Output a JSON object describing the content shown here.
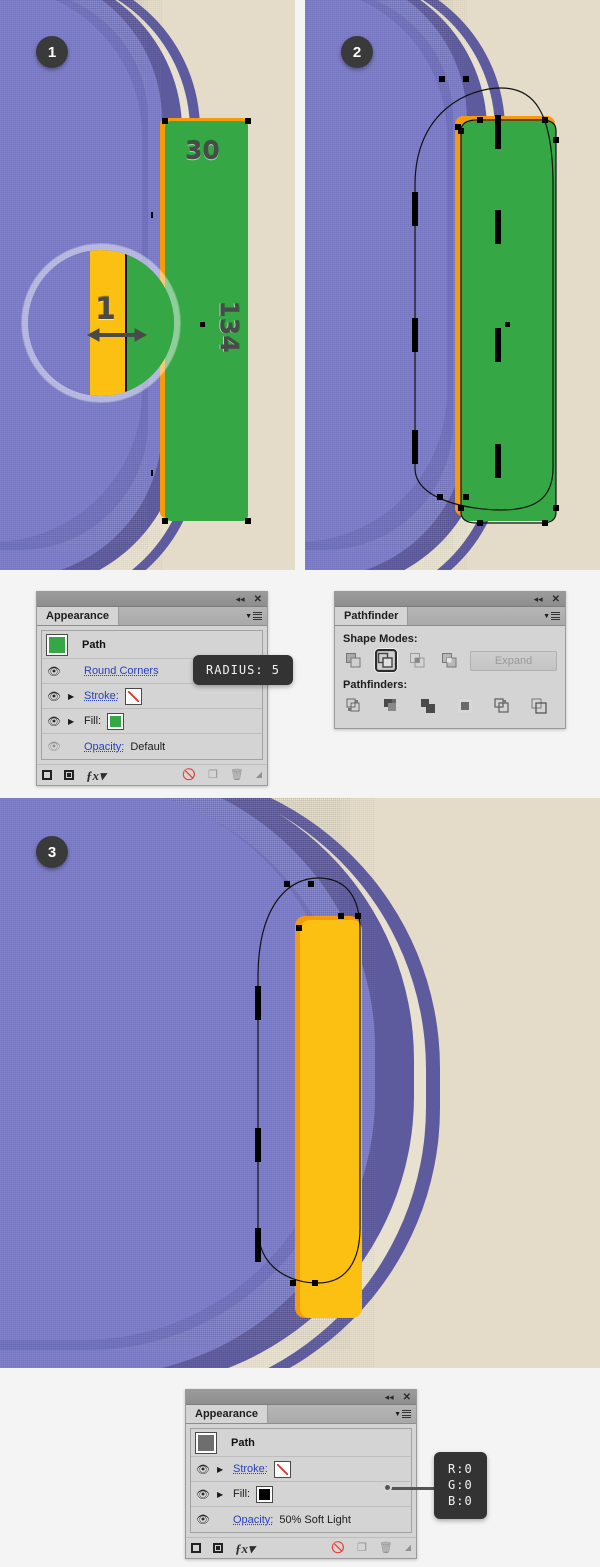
{
  "steps": [
    {
      "number": "1",
      "measure_width": "30",
      "measure_height": "134",
      "magnified_value": "1"
    },
    {
      "number": "2"
    },
    {
      "number": "3"
    }
  ],
  "appearance_panel_top": {
    "title": "Appearance",
    "collapse_icon": "collapse-double-arrow-icon",
    "close_icon": "close-icon",
    "menu_icon": "panel-menu-icon",
    "target_label": "Path",
    "target_swatch_color": "#35a745",
    "rows": [
      {
        "id": "round-corners",
        "label": "Round Corners",
        "link": true,
        "visible": true,
        "expandable": false
      },
      {
        "id": "stroke",
        "label": "Stroke:",
        "link": true,
        "visible": true,
        "expandable": true,
        "swatch": "none"
      },
      {
        "id": "fill",
        "label": "Fill:",
        "link": false,
        "visible": true,
        "expandable": true,
        "swatch": "#35a745"
      },
      {
        "id": "opacity",
        "label": "Opacity:",
        "value": "Default",
        "link": true,
        "visible": false,
        "expandable": false
      }
    ],
    "footer_icons": [
      "add-new-stroke-icon",
      "add-new-fill-icon",
      "add-new-effect-icon",
      "clear-appearance-icon",
      "duplicate-item-icon",
      "delete-item-icon",
      "resize-grip-icon"
    ]
  },
  "appearance_panel_bottom": {
    "title": "Appearance",
    "collapse_icon": "collapse-double-arrow-icon",
    "close_icon": "close-icon",
    "menu_icon": "panel-menu-icon",
    "target_label": "Path",
    "target_swatch_color": "#6e6e6e",
    "rows": [
      {
        "id": "stroke",
        "label": "Stroke:",
        "link": true,
        "visible": true,
        "expandable": true,
        "swatch": "none"
      },
      {
        "id": "fill",
        "label": "Fill:",
        "link": false,
        "visible": true,
        "expandable": true,
        "swatch": "#000000"
      },
      {
        "id": "opacity",
        "label": "Opacity:",
        "value": "50% Soft Light",
        "link": true,
        "visible": true,
        "expandable": false
      }
    ],
    "footer_icons": [
      "add-new-stroke-icon",
      "add-new-fill-icon",
      "add-new-effect-icon",
      "clear-appearance-icon",
      "duplicate-item-icon",
      "delete-item-icon",
      "resize-grip-icon"
    ]
  },
  "pathfinder_panel": {
    "title": "Pathfinder",
    "collapse_icon": "collapse-double-arrow-icon",
    "close_icon": "close-icon",
    "menu_icon": "panel-menu-icon",
    "shape_modes_label": "Shape Modes:",
    "pathfinders_label": "Pathfinders:",
    "expand_label": "Expand",
    "shape_modes": [
      {
        "id": "unite",
        "selected": false
      },
      {
        "id": "minus-front",
        "selected": true
      },
      {
        "id": "intersect",
        "selected": false
      },
      {
        "id": "exclude",
        "selected": false
      }
    ],
    "pathfinders": [
      {
        "id": "divide"
      },
      {
        "id": "trim"
      },
      {
        "id": "merge"
      },
      {
        "id": "crop"
      },
      {
        "id": "outline"
      },
      {
        "id": "minus-back"
      }
    ]
  },
  "tooltips": {
    "radius": "RADIUS: 5",
    "rgb": "R:0\nG:0\nB:0"
  },
  "colors": {
    "background": "#f4f4f4",
    "paper_beige": "#e4dcc8",
    "cover_purple": "#7b7cc8",
    "cover_purple_dark": "#5d5a9e",
    "page_cream": "#e8e1cf",
    "green": "#35a745",
    "orange": "#f59a0b",
    "yellow": "#fcc013",
    "badge": "#3a3a3a",
    "tooltip_bg": "#333333",
    "link_blue": "#2a3fb8"
  }
}
